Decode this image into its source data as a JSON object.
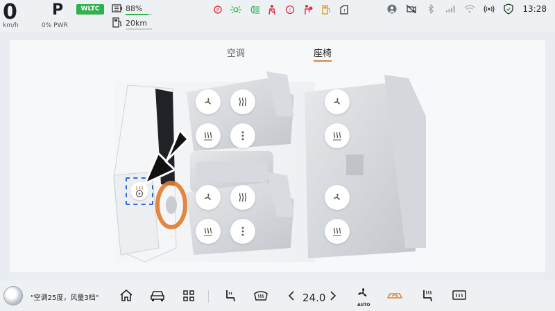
{
  "status": {
    "speed": "0",
    "speed_unit": "km/h",
    "gear": "P",
    "power": "0% PWR",
    "cycle_badge": "WLTC",
    "battery_percent": "88%",
    "battery_level": 0.88,
    "range": "20km",
    "time": "13:28",
    "icons": {
      "warnings": [
        "parking-brake-icon",
        "side-light-icon",
        "headlight-icon",
        "seatbelt-icon",
        "steering-warning-icon",
        "airbag-icon",
        "fuel-icon",
        "door-open-icon"
      ],
      "system": [
        "avatar-icon",
        "camera-off-icon",
        "bluetooth-icon",
        "cellular-signal-icon",
        "wifi-icon",
        "hotspot-icon",
        "shield-icon"
      ]
    },
    "colors": {
      "badge": "#2fb24c",
      "warning": "#e0303a",
      "indicator": "#2fb24c"
    }
  },
  "tabs": [
    {
      "label": "空调",
      "active": false
    },
    {
      "label": "座椅",
      "active": true
    }
  ],
  "accent_color": "#d9823b",
  "seat_controls": {
    "front_left": [
      "fan-icon",
      "heat-icon",
      "heat-wave-icon",
      "more-icon"
    ],
    "front_right": [
      "fan-icon",
      "heat-icon",
      "heat-wave-icon",
      "more-icon"
    ],
    "rear": [
      "fan-icon",
      "heat-wave-icon",
      "fan-icon",
      "heat-wave-icon"
    ],
    "steering_wheel": "steering-heat-icon"
  },
  "dock": {
    "voice_text": "\"空调25度，风量3档\"",
    "temperature": "24.0",
    "auto_label": "AUTO",
    "icons": [
      "home-icon",
      "car-icon",
      "apps-grid-icon",
      "seat-massage-icon",
      "front-defrost-icon",
      "chevron-left-icon",
      "chevron-right-icon",
      "fan-auto-icon",
      "recirculation-icon",
      "seat-heat-icon",
      "rear-defrost-icon"
    ]
  }
}
